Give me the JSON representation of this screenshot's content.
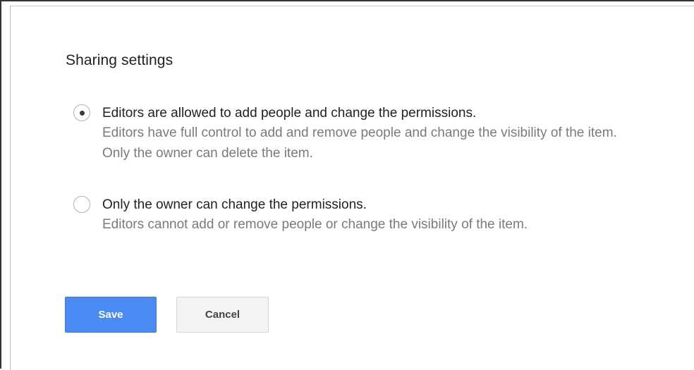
{
  "dialog": {
    "title": "Sharing settings",
    "options": [
      {
        "label": "Editors are allowed to add people and change the permissions.",
        "description": "Editors have full control to add and remove people and change the visibility of the item. Only the owner can delete the item.",
        "selected": true
      },
      {
        "label": "Only the owner can change the permissions.",
        "description": "Editors cannot add or remove people or change the visibility of the item.",
        "selected": false
      }
    ],
    "save_label": "Save",
    "cancel_label": "Cancel"
  },
  "colors": {
    "primary_button": "#4a8af4",
    "secondary_button": "#f3f3f3",
    "description_text": "#7a7a7a"
  }
}
